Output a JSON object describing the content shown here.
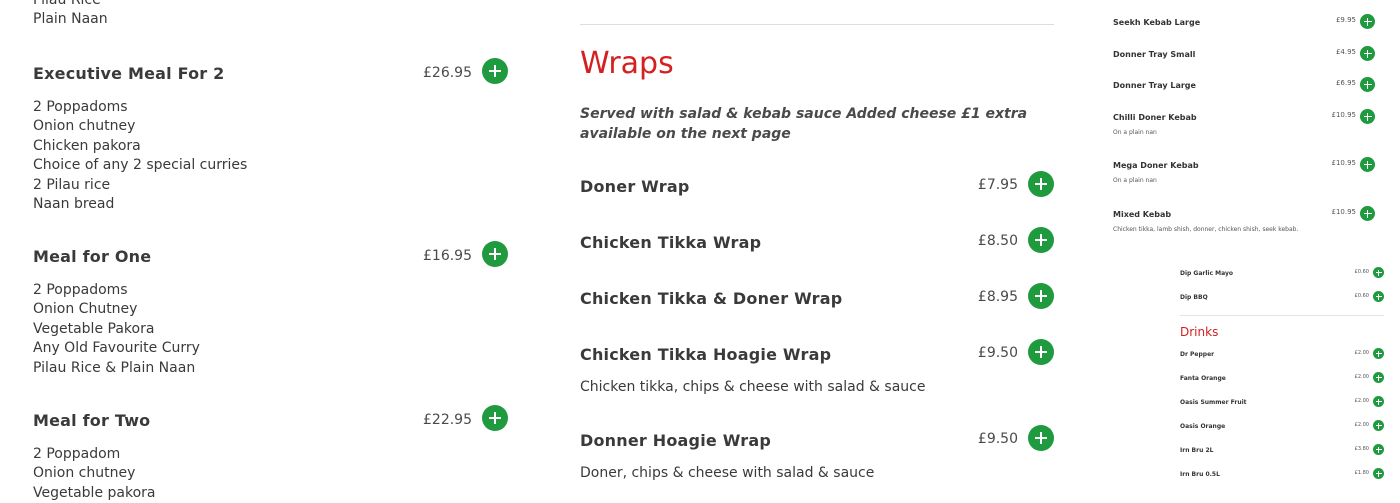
{
  "left": {
    "lead_lines": [
      "Pilau Rice",
      "Plain Naan"
    ],
    "meals": [
      {
        "title": "Executive Meal For 2",
        "price": "£26.95",
        "lines": [
          "2 Poppadoms",
          "Onion chutney",
          "Chicken pakora",
          "Choice of any 2 special curries",
          "2 Pilau rice",
          "Naan bread"
        ]
      },
      {
        "title": "Meal for One",
        "price": "£16.95",
        "lines": [
          "2 Poppadoms",
          "Onion Chutney",
          "Vegetable Pakora",
          "Any Old Favourite Curry",
          "Pilau Rice & Plain Naan"
        ]
      },
      {
        "title": "Meal for Two",
        "price": "£22.95",
        "lines": [
          "2 Poppadom",
          "Onion chutney",
          "Vegetable pakora"
        ]
      }
    ]
  },
  "middle": {
    "section_title": "Wraps",
    "section_description": "Served with salad & kebab sauce Added cheese £1 extra available on the next page",
    "items": [
      {
        "title": "Doner Wrap",
        "price": "£7.95",
        "description": ""
      },
      {
        "title": "Chicken Tikka Wrap",
        "price": "£8.50",
        "description": ""
      },
      {
        "title": "Chicken Tikka & Doner Wrap",
        "price": "£8.95",
        "description": ""
      },
      {
        "title": "Chicken Tikka Hoagie Wrap",
        "price": "£9.50",
        "description": "Chicken tikka, chips & cheese with salad & sauce"
      },
      {
        "title": "Donner Hoagie Wrap",
        "price": "£9.50",
        "description": "Doner, chips & cheese with salad & sauce"
      }
    ]
  },
  "right": {
    "items": [
      {
        "title": "Seekh Kebab Large",
        "price": "£9.95",
        "description": ""
      },
      {
        "title": "Donner Tray Small",
        "price": "£4.95",
        "description": ""
      },
      {
        "title": "Donner Tray Large",
        "price": "£6.95",
        "description": ""
      },
      {
        "title": "Chilli Doner Kebab",
        "price": "£10.95",
        "description": "On a plain nan"
      },
      {
        "title": "Mega Doner Kebab",
        "price": "£10.95",
        "description": "On a plain nan"
      },
      {
        "title": "Mixed Kebab",
        "price": "£10.95",
        "description": "Chicken tikka, lamb shish, donner, chicken shish, seek kebab."
      }
    ],
    "secondary": {
      "dips": [
        {
          "title": "Dip Garlic Mayo",
          "price": "£0.60"
        },
        {
          "title": "Dip BBQ",
          "price": "£0.60"
        }
      ],
      "section_title": "Drinks",
      "drinks": [
        {
          "title": "Dr Pepper",
          "price": "£2.00"
        },
        {
          "title": "Fanta Orange",
          "price": "£2.00"
        },
        {
          "title": "Oasis Summer Fruit",
          "price": "£2.00"
        },
        {
          "title": "Oasis Orange",
          "price": "£2.00"
        },
        {
          "title": "Irn Bru 2L",
          "price": "£3.80"
        },
        {
          "title": "Irn Bru 0.5L",
          "price": "£1.80"
        }
      ]
    }
  },
  "colors": {
    "accent_red": "#d42020",
    "add_button_green": "#1f9a3f",
    "text": "#3a3a3a"
  },
  "icons": {
    "add": "plus-circle-icon"
  }
}
